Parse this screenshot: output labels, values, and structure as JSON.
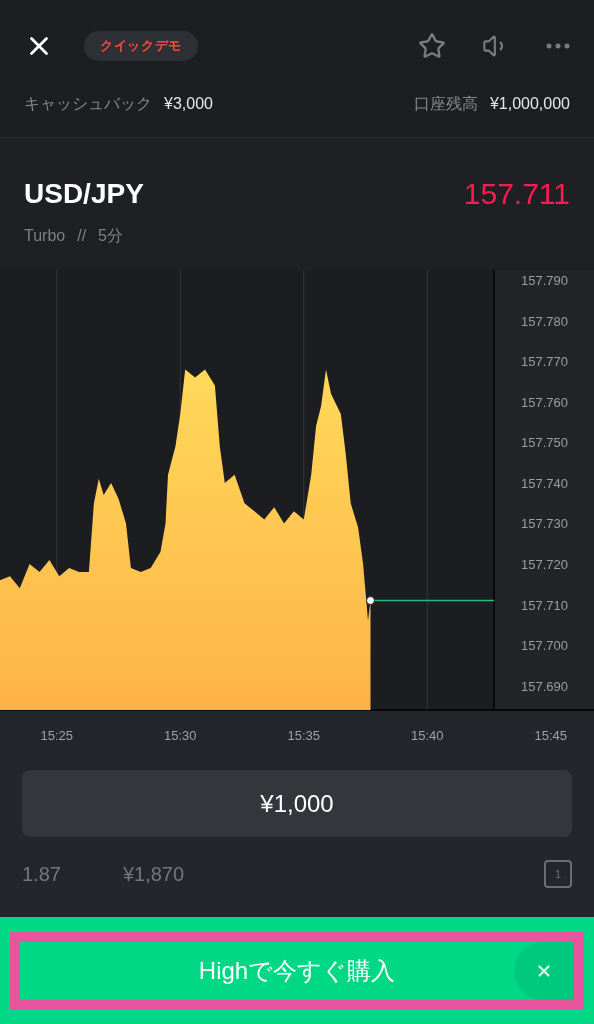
{
  "header": {
    "badge": "クイックデモ",
    "cashback": {
      "label": "キャッシュバック",
      "value": "¥3,000"
    },
    "balance": {
      "label": "口座残高",
      "value": "¥1,000,000"
    }
  },
  "asset": {
    "name": "USD/JPY",
    "price": "157.711",
    "type": "Turbo",
    "separator": "//",
    "duration": "5分"
  },
  "chart": {
    "chart_data": {
      "type": "area",
      "x": [
        922.7,
        923.1,
        923.5,
        923.9,
        924.3,
        924.7,
        925.1,
        925.5,
        925.9,
        926.3,
        926.5,
        926.7,
        926.9,
        927.2,
        927.5,
        927.8,
        928.0,
        928.4,
        928.8,
        929.2,
        929.4,
        929.5,
        929.8,
        930.0,
        930.2,
        930.6,
        931.0,
        931.4,
        931.6,
        931.8,
        932.2,
        932.6,
        933.0,
        933.4,
        933.8,
        934.2,
        934.6,
        935.0,
        935.3,
        935.5,
        935.7,
        935.9,
        936.1,
        936.5,
        936.7,
        936.9,
        937.2,
        937.4,
        937.6,
        937.7
      ],
      "series": [
        {
          "color": "#ffb347",
          "values": [
            157.716,
            157.717,
            157.714,
            157.72,
            157.718,
            157.721,
            157.717,
            157.719,
            157.718,
            157.718,
            157.735,
            157.741,
            157.737,
            157.74,
            157.736,
            157.73,
            157.719,
            157.718,
            157.719,
            157.723,
            157.73,
            157.742,
            157.749,
            157.757,
            157.768,
            157.766,
            157.768,
            157.764,
            157.749,
            157.74,
            157.742,
            157.735,
            157.733,
            157.731,
            157.734,
            157.73,
            157.733,
            157.731,
            157.742,
            157.754,
            157.759,
            157.768,
            157.762,
            157.757,
            157.747,
            157.735,
            157.729,
            157.72,
            157.706,
            157.711
          ]
        }
      ],
      "grid": true,
      "ref_lines": [
        {
          "axis": "y",
          "value": 157.711,
          "color": "#1fbf7a"
        }
      ],
      "xlim": [
        922.7,
        946.75
      ],
      "ylim": [
        157.684,
        157.7925
      ],
      "xticks": [
        {
          "value": 925,
          "label": "15:25"
        },
        {
          "value": 930,
          "label": "15:30"
        },
        {
          "value": 935,
          "label": "15:35"
        },
        {
          "value": 940,
          "label": "15:40"
        },
        {
          "value": 945,
          "label": "15:45"
        }
      ],
      "yticks": [
        {
          "value": 157.79,
          "label": "157.790"
        },
        {
          "value": 157.78,
          "label": "157.780"
        },
        {
          "value": 157.77,
          "label": "157.770"
        },
        {
          "value": 157.76,
          "label": "157.760"
        },
        {
          "value": 157.75,
          "label": "157.750"
        },
        {
          "value": 157.74,
          "label": "157.740"
        },
        {
          "value": 157.73,
          "label": "157.730"
        },
        {
          "value": 157.72,
          "label": "157.720"
        },
        {
          "value": 157.71,
          "label": "157.710"
        },
        {
          "value": 157.7,
          "label": "157.700"
        },
        {
          "value": 157.69,
          "label": "157.690"
        }
      ]
    }
  },
  "order": {
    "amount": "¥1,000",
    "payout_rate": "1.87",
    "payout": "¥1,870",
    "one_click": "1"
  },
  "buy_button": {
    "label": "Highで今すぐ購入",
    "highlighted": true
  }
}
